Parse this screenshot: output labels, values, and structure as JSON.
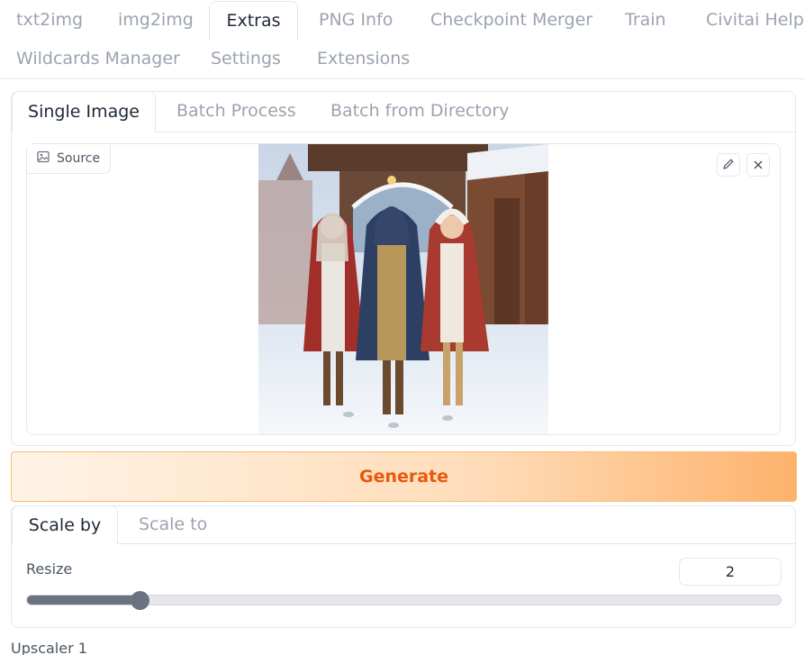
{
  "top_tabs": [
    {
      "label": "txt2img"
    },
    {
      "label": "img2img"
    },
    {
      "label": "Extras",
      "active": true
    },
    {
      "label": "PNG Info"
    },
    {
      "label": "Checkpoint Merger"
    },
    {
      "label": "Train"
    },
    {
      "label": "Civitai Helpe"
    },
    {
      "label": "Wildcards Manager"
    },
    {
      "label": "Settings"
    },
    {
      "label": "Extensions"
    }
  ],
  "extras": {
    "tabs": [
      {
        "label": "Single Image",
        "active": true
      },
      {
        "label": "Batch Process"
      },
      {
        "label": "Batch from Directory"
      }
    ],
    "source": {
      "label": "Source",
      "edit_icon": "pencil-icon",
      "clear_icon": "close-icon"
    },
    "generate_label": "Generate",
    "scale_tabs": [
      {
        "label": "Scale by",
        "active": true
      },
      {
        "label": "Scale to"
      }
    ],
    "resize": {
      "label": "Resize",
      "value": "2",
      "slider_fraction": 0.15
    },
    "upscaler1_label": "Upscaler 1"
  },
  "colors": {
    "accent": "#ea580c",
    "border": "#e5e7eb",
    "slider": "#6b7280"
  }
}
